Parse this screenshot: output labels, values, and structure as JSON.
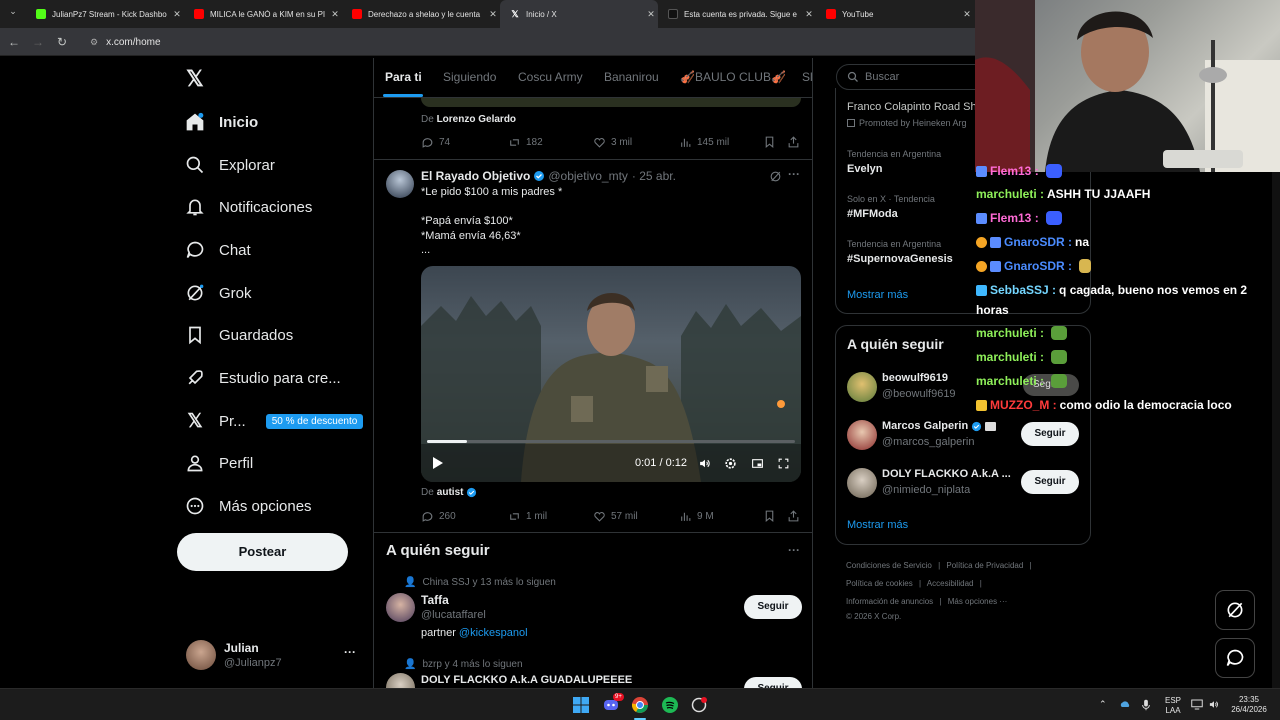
{
  "browser": {
    "tabs": [
      {
        "title": "JulianPz7 Stream - Kick Dashbo",
        "favicon_color": "#53fc18"
      },
      {
        "title": "MILICA le GANÓ a KIM en su PI",
        "favicon_color": "#ff0000"
      },
      {
        "title": "Derechazo a shelao y le cuenta",
        "favicon_color": "#ff0000"
      },
      {
        "title": "Inicio / X",
        "favicon_color": "#ffffff"
      },
      {
        "title": "Esta cuenta es privada. Sigue e",
        "favicon_color": "#ffffff"
      },
      {
        "title": "YouTube",
        "favicon_color": "#ff0000"
      }
    ],
    "close_glyph": "✕",
    "url": "x.com/home"
  },
  "nav": {
    "items": [
      {
        "label": "Inicio",
        "icon": "home-icon"
      },
      {
        "label": "Explorar",
        "icon": "search-icon"
      },
      {
        "label": "Notificaciones",
        "icon": "bell-icon"
      },
      {
        "label": "Chat",
        "icon": "chat-icon"
      },
      {
        "label": "Grok",
        "icon": "grok-icon"
      },
      {
        "label": "Guardados",
        "icon": "bookmark-icon"
      },
      {
        "label": "Estudio para cre...",
        "icon": "rocket-icon"
      },
      {
        "label": "Pr...",
        "icon": "x-logo-icon"
      },
      {
        "label": "Perfil",
        "icon": "person-icon"
      },
      {
        "label": "Más opciones",
        "icon": "more-circle-icon"
      }
    ],
    "premium_badge": "50 % de descuento",
    "post_button": "Postear",
    "account": {
      "name": "Julian",
      "handle": "@Julianpz7",
      "more": "···"
    }
  },
  "timeline": {
    "tabs": [
      "Para ti",
      "Siguiendo",
      "Coscu Army",
      "Bananirou",
      "🎻BAULO CLUB🎻",
      "Sl"
    ],
    "prev_post": {
      "from_prefix": "De",
      "from": "Lorenzo Gelardo",
      "stats": {
        "replies": "74",
        "reposts": "182",
        "likes": "3 mil",
        "views": "145 mil"
      }
    },
    "post": {
      "author": "El Rayado Objetivo",
      "handle": "@objetivo_mty",
      "date": "· 25 abr.",
      "lines": [
        "*Le pido $100 a mis padres *",
        "",
        "*Papá envía $100*",
        "*Mamá envía 46,63*",
        "..."
      ],
      "video": {
        "time": "0:01 / 0:12",
        "progress": 0.11
      },
      "from_prefix": "De",
      "from": "autist",
      "stats": {
        "replies": "260",
        "reposts": "1 mil",
        "likes": "57 mil",
        "views": "9 M"
      }
    },
    "who_to_follow": {
      "title": "A quién seguir",
      "more": "···",
      "items": [
        {
          "context": "China SSJ y 13 más lo siguen",
          "name": "Taffa",
          "handle": "@lucataffarel",
          "bio_prefix": "partner",
          "bio_link": "@kickespanol",
          "button": "Seguir"
        },
        {
          "context": "bzrp y 4 más lo siguen",
          "name": "DOLY FLACKKO A.k.A GUADALUPEEEE",
          "button": "Seguir"
        }
      ]
    }
  },
  "right": {
    "search_placeholder": "Buscar",
    "promo": {
      "title": "Franco Colapinto Road Sh",
      "promoted": "Promoted by Heineken Arg"
    },
    "trends": [
      {
        "context": "Tendencia en Argentina",
        "name": "Evelyn"
      },
      {
        "context": "Solo en X · Tendencia",
        "name": "#MFModa"
      },
      {
        "context": "Tendencia en Argentina",
        "name": "#SupernovaGenesis"
      }
    ],
    "show_more": "Mostrar más",
    "follow": {
      "title": "A quién seguir",
      "users": [
        {
          "name": "beowulf9619",
          "handle": "@beowulf9619"
        },
        {
          "name": "Marcos Galperin",
          "handle": "@marcos_galperin",
          "button": "Seguir"
        },
        {
          "name": "DOLY FLACKKO A.k.A ...",
          "handle": "@nimiedo_niplata",
          "button": "Seguir"
        }
      ],
      "show_more": "Mostrar más"
    },
    "footer": {
      "row1": [
        "Condiciones de Servicio",
        "Política de Privacidad"
      ],
      "row2": [
        "Política de cookies",
        "Accesibilidad"
      ],
      "row3": [
        "Información de anuncios",
        "Más opciones ···"
      ],
      "copyright": "© 2026 X Corp."
    }
  },
  "stream_chat": [
    {
      "user": "Flem13 :",
      "msg": "",
      "color": "#ff6bd6",
      "emote": "#3b5fff"
    },
    {
      "user": "marchuleti :",
      "msg": "ASHH TU JJAAFH",
      "color": "#8ff05a"
    },
    {
      "user": "Flem13 :",
      "msg": "",
      "color": "#ff6bd6",
      "emote": "#3b5fff"
    },
    {
      "user": "GnaroSDR :",
      "msg": "na",
      "color": "#4b8cff"
    },
    {
      "user": "GnaroSDR :",
      "msg": "",
      "color": "#4b8cff",
      "emote": "#d8b650"
    },
    {
      "user": "SebbaSSJ :",
      "msg": "q cagada, bueno nos vemos en 2",
      "color": "#74d6ff"
    },
    {
      "user": "",
      "msg": "horas",
      "color": "#ffffff"
    },
    {
      "user": "marchuleti :",
      "msg": "",
      "color": "#8ff05a",
      "emote": "#5a9e3a"
    },
    {
      "user": "marchuleti :",
      "msg": "",
      "color": "#8ff05a",
      "emote": "#5a9e3a"
    },
    {
      "user": "marchuleti :",
      "msg": "",
      "color": "#8ff05a",
      "emote": "#5a9e3a"
    },
    {
      "user": "MUZZO_M :",
      "msg": "como odio la democracia loco",
      "color": "#ff3b3b"
    }
  ],
  "chat_overlap_label": "Segu",
  "taskbar": {
    "lang": "ESP",
    "layout": "LAA",
    "time": "23:35",
    "date": "26/4/2026",
    "discord_badge": "9+"
  }
}
